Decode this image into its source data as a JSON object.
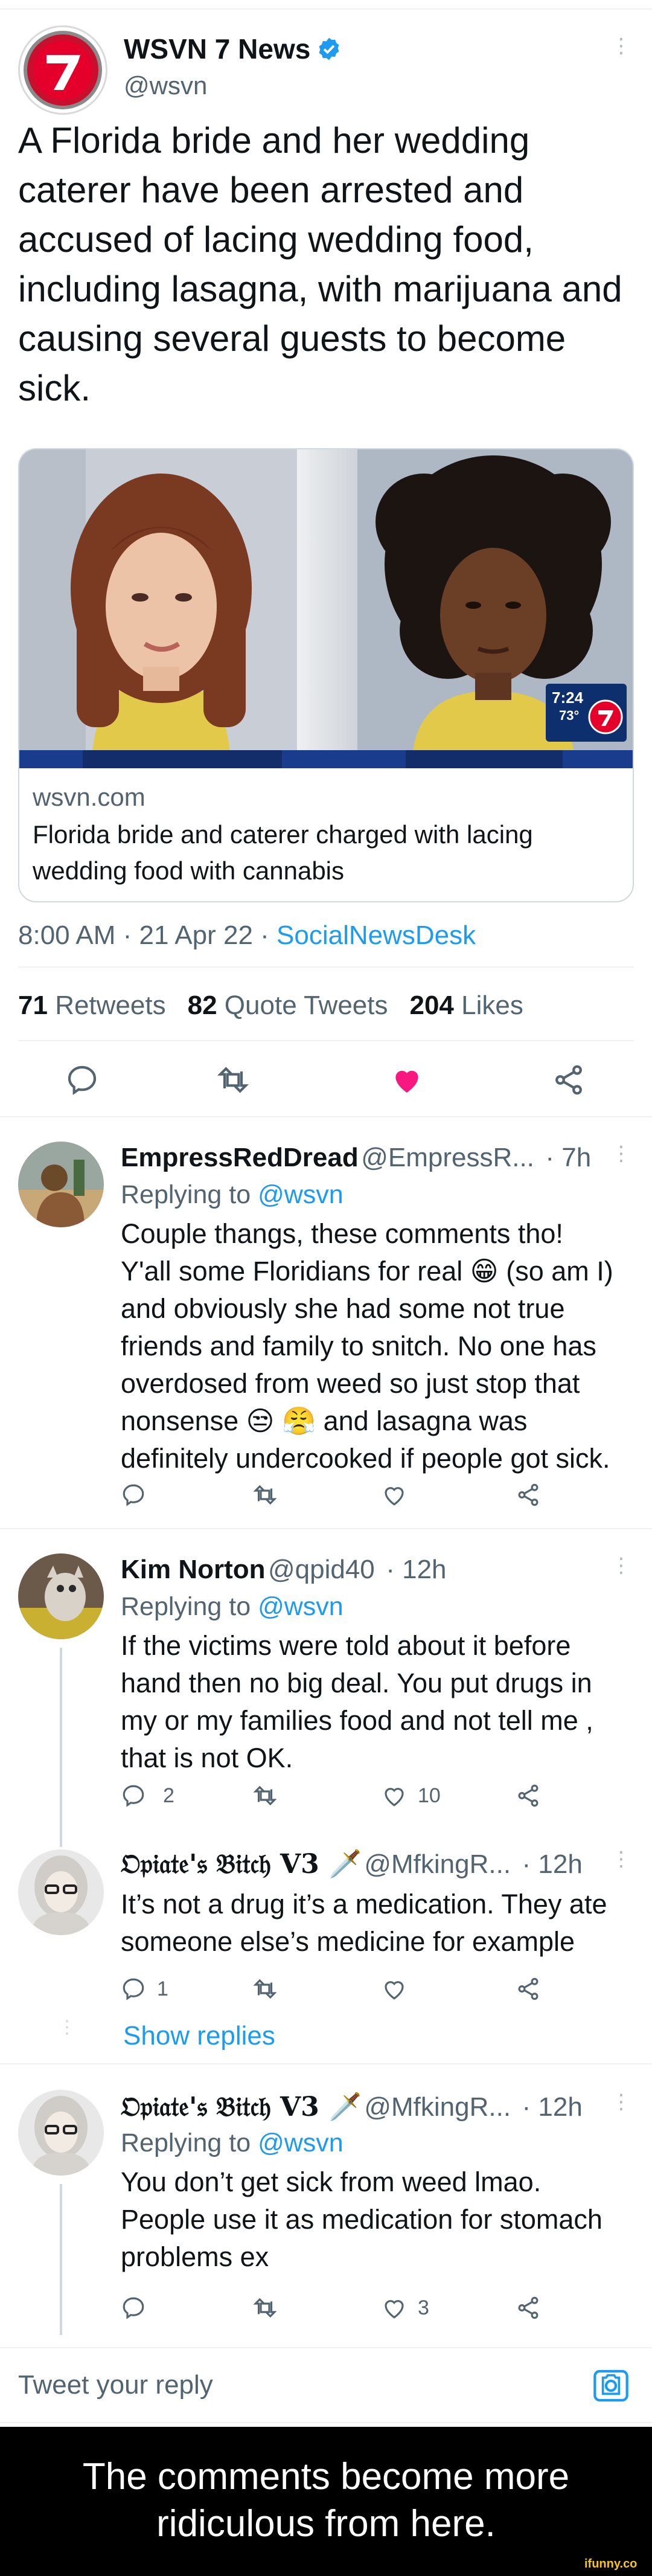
{
  "main_tweet": {
    "display_name": "WSVN 7 News",
    "handle": "@wsvn",
    "text": "A Florida bride and her wedding caterer have been arrested and accused of lacing wedding food, including lasagna, with marijuana and causing several guests to become sick.",
    "card": {
      "domain": "wsvn.com",
      "title": "Florida bride and caterer charged with lacing wedding food with cannabis",
      "tv_time": "7:24",
      "tv_temp": "73°"
    },
    "timestamp": "8:00 AM · 21 Apr 22 · ",
    "source": "SocialNewsDesk",
    "stats": {
      "retweets_count": "71",
      "retweets_label": "Retweets",
      "quotes_count": "82",
      "quotes_label": "Quote Tweets",
      "likes_count": "204",
      "likes_label": "Likes"
    }
  },
  "replies": [
    {
      "display_name": "EmpressRedDread",
      "handle": "@EmpressR...",
      "time": "· 7h",
      "replying_prefix": "Replying to",
      "replying_to": "@wsvn",
      "lines": [
        "Couple thangs, these comments tho!",
        "Y'all some Floridians for real 😁 (so am I)",
        "and obviously she had some not true",
        "friends and family to snitch. No one has",
        "overdosed from weed so just stop that",
        "nonsense 😒 😤 and lasagna was",
        "definitely undercooked if people got sick."
      ],
      "reply_count": "",
      "like_count": ""
    },
    {
      "display_name": "Kim Norton",
      "handle": "@qpid40",
      "time": "· 12h",
      "replying_prefix": "Replying to",
      "replying_to": "@wsvn",
      "lines": [
        "If the victims were told about it before",
        "hand then no big deal. You put drugs in",
        "my or my families food and not tell me ,",
        "that is not OK."
      ],
      "reply_count": "2",
      "like_count": "10"
    },
    {
      "display_name": "𝔒𝔭𝔦𝔞𝔱𝔢'𝔰 𝔅𝔦𝔱𝔠𝔥 V3 🗡️",
      "handle": "@MfkingR...",
      "time": "· 12h",
      "lines": [
        "It’s not a drug it’s a medication. They ate",
        "someone else’s medicine for example"
      ],
      "reply_count": "1",
      "like_count": ""
    },
    {
      "display_name": "𝔒𝔭𝔦𝔞𝔱𝔢'𝔰 𝔅𝔦𝔱𝔠𝔥 V3 🗡️",
      "handle": "@MfkingR...",
      "time": "· 12h",
      "replying_prefix": "Replying to",
      "replying_to": "@wsvn",
      "lines": [
        "You don’t get sick from weed lmao.",
        "People use it as medication for stomach",
        "problems ex"
      ],
      "reply_count": "",
      "like_count": "3"
    }
  ],
  "show_replies": "Show replies",
  "compose_placeholder": "Tweet your reply",
  "caption": {
    "line1": "The comments become more",
    "line2": "ridiculous from here."
  },
  "watermark": "ifunny.co",
  "colors": {
    "accent": "#1d9bf0",
    "like_active": "#f91880",
    "caption_bg": "#000000"
  }
}
